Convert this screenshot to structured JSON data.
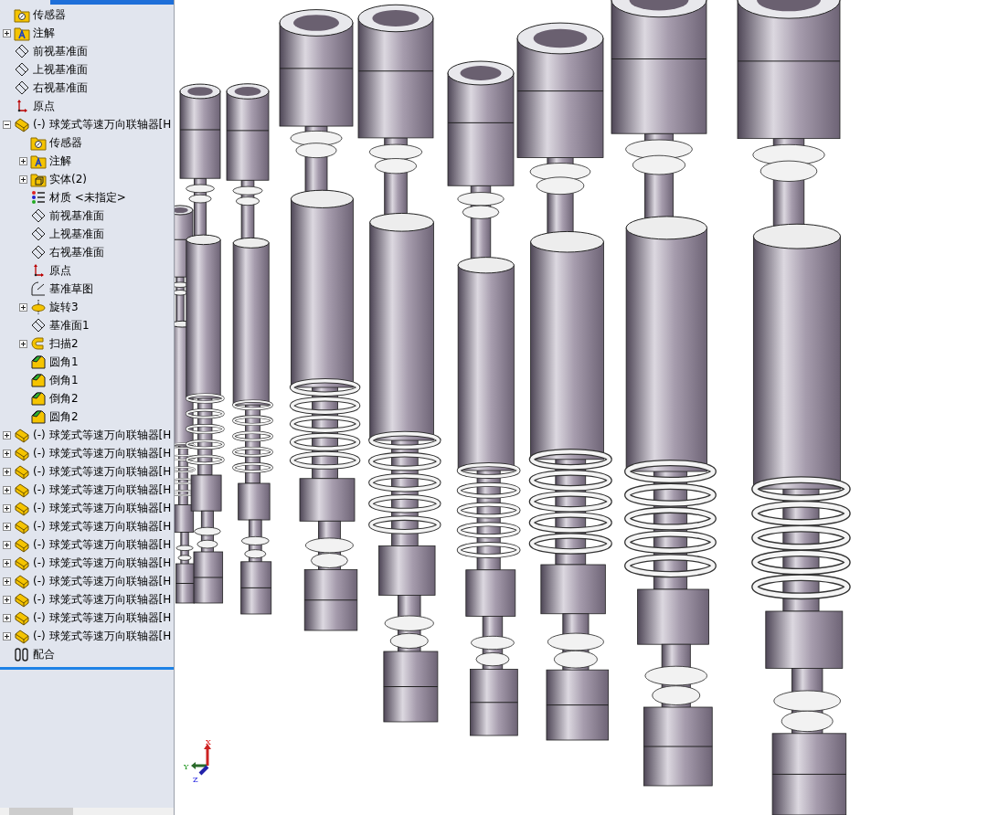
{
  "feature_tree": {
    "items": [
      {
        "kind": "sensor",
        "label": "传感器"
      },
      {
        "kind": "annotation",
        "label": "注解",
        "expanded": false
      },
      {
        "kind": "plane",
        "label": "前视基准面"
      },
      {
        "kind": "plane",
        "label": "上视基准面"
      },
      {
        "kind": "plane",
        "label": "右视基准面"
      },
      {
        "kind": "origin",
        "label": "原点"
      },
      {
        "kind": "part",
        "label": "(-) 球笼式等速万向联轴器[H",
        "expanded": true,
        "children": [
          {
            "kind": "sensor",
            "label": "传感器"
          },
          {
            "kind": "annotation",
            "label": "注解",
            "expanded": false
          },
          {
            "kind": "solid",
            "label": "实体(2)",
            "expanded": false
          },
          {
            "kind": "material",
            "label": "材质 <未指定>"
          },
          {
            "kind": "plane",
            "label": "前视基准面"
          },
          {
            "kind": "plane",
            "label": "上视基准面"
          },
          {
            "kind": "plane",
            "label": "右视基准面"
          },
          {
            "kind": "origin",
            "label": "原点"
          },
          {
            "kind": "sketch",
            "label": "基准草图"
          },
          {
            "kind": "revolve",
            "label": "旋转3",
            "expanded": false
          },
          {
            "kind": "plane",
            "label": "基准面1"
          },
          {
            "kind": "sweep",
            "label": "扫描2",
            "expanded": false
          },
          {
            "kind": "fillet",
            "label": "圆角1"
          },
          {
            "kind": "fillet",
            "label": "倒角1"
          },
          {
            "kind": "fillet",
            "label": "倒角2"
          },
          {
            "kind": "fillet",
            "label": "圆角2"
          }
        ]
      },
      {
        "kind": "part",
        "label": "(-) 球笼式等速万向联轴器[H",
        "expanded": false
      },
      {
        "kind": "part",
        "label": "(-) 球笼式等速万向联轴器[H",
        "expanded": false
      },
      {
        "kind": "part",
        "label": "(-) 球笼式等速万向联轴器[H",
        "expanded": false
      },
      {
        "kind": "part",
        "label": "(-) 球笼式等速万向联轴器[H",
        "expanded": false
      },
      {
        "kind": "part",
        "label": "(-) 球笼式等速万向联轴器[H",
        "expanded": false
      },
      {
        "kind": "part",
        "label": "(-) 球笼式等速万向联轴器[H",
        "expanded": false
      },
      {
        "kind": "part",
        "label": "(-) 球笼式等速万向联轴器[H",
        "expanded": false
      },
      {
        "kind": "part",
        "label": "(-) 球笼式等速万向联轴器[H",
        "expanded": false
      },
      {
        "kind": "part",
        "label": "(-) 球笼式等速万向联轴器[H",
        "expanded": false
      },
      {
        "kind": "part",
        "label": "(-) 球笼式等速万向联轴器[H",
        "expanded": false
      },
      {
        "kind": "part",
        "label": "(-) 球笼式等速万向联轴器[H",
        "expanded": false
      },
      {
        "kind": "part",
        "label": "(-) 球笼式等速万向联轴器[H",
        "expanded": false
      },
      {
        "kind": "mate",
        "label": "配合"
      }
    ]
  },
  "triad": {
    "x": "X",
    "y": "Y",
    "z": "Z"
  }
}
